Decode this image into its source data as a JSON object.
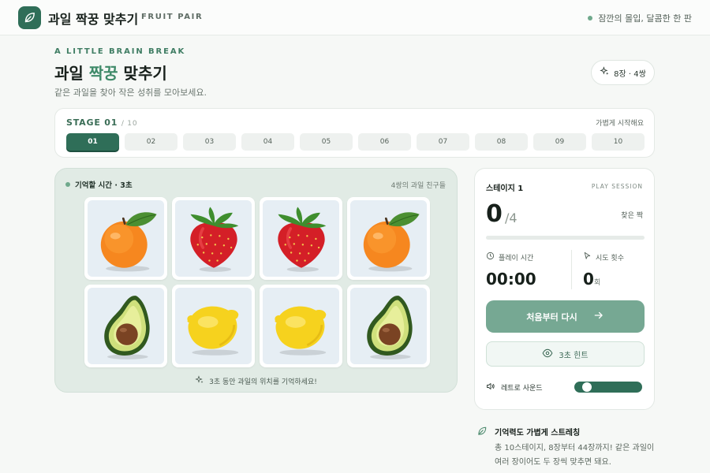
{
  "header": {
    "title": "과일 짝꿍 맞추기",
    "subtitle": "FRUIT PAIR",
    "tagline": "잠깐의 몰입, 달콤한 한 판"
  },
  "hero": {
    "eyebrow": "A LITTLE BRAIN BREAK",
    "title_prefix": "과일 ",
    "title_accent": "짝꿍",
    "title_suffix": " 맞추기",
    "description": "같은 과일을 찾아 작은 성취를 모아보세요.",
    "count_badge": "8장 · 4쌍"
  },
  "stages": {
    "label": "STAGE 01",
    "total": "/ 10",
    "hint": "가볍게 시작해요",
    "items": [
      "01",
      "02",
      "03",
      "04",
      "05",
      "06",
      "07",
      "08",
      "09",
      "10"
    ],
    "active_index": 0
  },
  "board": {
    "status": "기억할 시간 · 3초",
    "meta": "4쌍의 과일 친구들",
    "footer": "3초 동안 과일의 위치를 기억하세요!",
    "cards": [
      "orange",
      "strawberry",
      "strawberry",
      "orange",
      "avocado",
      "lemon",
      "lemon",
      "avocado"
    ]
  },
  "session": {
    "title": "스테이지 1",
    "tag": "PLAY SESSION",
    "matched": "0",
    "total_pairs": "/4",
    "matched_label": "찾은 짝",
    "progress": 0,
    "time_label": "플레이 시간",
    "time_value": "00:00",
    "tries_label": "시도 횟수",
    "tries_value": "0",
    "tries_unit": "회",
    "restart_label": "처음부터 다시",
    "hint_label": "3초 힌트",
    "sound_label": "레트로 사운드",
    "sound_on": false
  },
  "tip": {
    "title": "기억력도 가볍게 스트레칭",
    "body": "총 10스테이지, 8장부터 44장까지! 같은 과일이 여러 장이어도 두 장씩 맞추면 돼요."
  },
  "colors": {
    "accent": "#2f6e58",
    "accent_light": "#76a893",
    "board_bg": "#e1ebe5",
    "page_bg": "#f6f8f6"
  },
  "icons": {
    "logo": "leaf-icon",
    "count": "sparkle-icon",
    "clock": "clock-icon",
    "cursor": "cursor-icon",
    "arrow": "arrow-right-icon",
    "eye": "eye-icon",
    "speaker": "speaker-icon"
  }
}
